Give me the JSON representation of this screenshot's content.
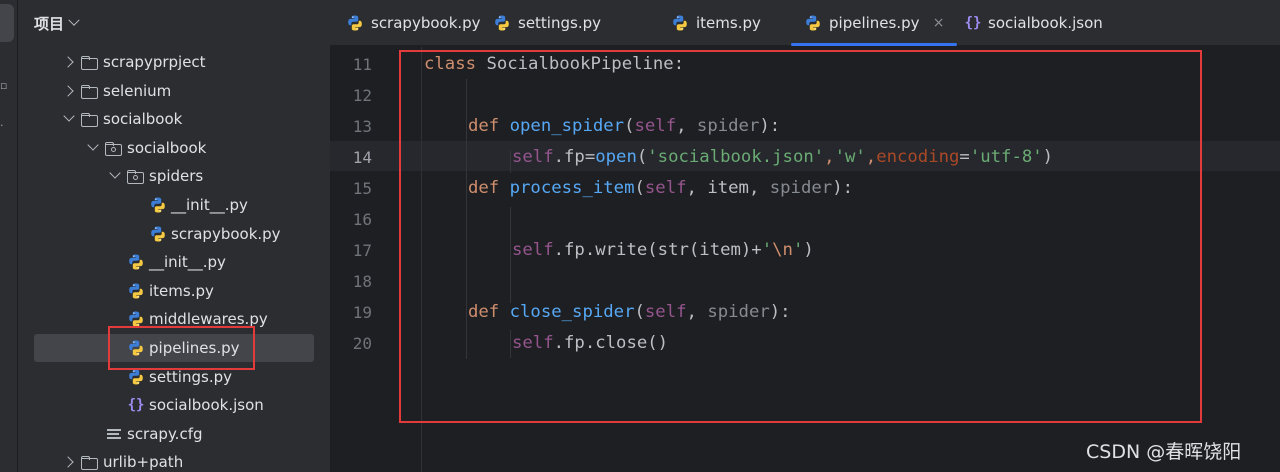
{
  "project": {
    "title": "项目",
    "tree": [
      {
        "label": "scrapyprpject",
        "type": "folder",
        "arrow": "right"
      },
      {
        "label": "selenium",
        "type": "folder",
        "arrow": "right"
      },
      {
        "label": "socialbook",
        "type": "folder",
        "arrow": "down"
      },
      {
        "label": "socialbook",
        "type": "package",
        "arrow": "down"
      },
      {
        "label": "spiders",
        "type": "package",
        "arrow": "down"
      },
      {
        "label": "__init__.py",
        "type": "py"
      },
      {
        "label": "scrapybook.py",
        "type": "py"
      },
      {
        "label": "__init__.py",
        "type": "py"
      },
      {
        "label": "items.py",
        "type": "py"
      },
      {
        "label": "middlewares.py",
        "type": "py"
      },
      {
        "label": "pipelines.py",
        "type": "py",
        "selected": true
      },
      {
        "label": "settings.py",
        "type": "py"
      },
      {
        "label": "socialbook.json",
        "type": "json"
      },
      {
        "label": "scrapy.cfg",
        "type": "cfg"
      },
      {
        "label": "urlib+path",
        "type": "folder",
        "arrow": "right"
      }
    ]
  },
  "tabs": [
    {
      "label": "scrapybook.py",
      "icon": "python-file-icon"
    },
    {
      "label": "settings.py",
      "icon": "python-file-icon"
    },
    {
      "label": "items.py",
      "icon": "python-file-icon"
    },
    {
      "label": "pipelines.py",
      "icon": "python-file-icon",
      "active": true,
      "close": "×"
    },
    {
      "label": "socialbook.json",
      "icon": "json-file-icon"
    }
  ],
  "json_icon_glyph": "{}",
  "editor": {
    "line_numbers": [
      "11",
      "12",
      "13",
      "14",
      "15",
      "16",
      "17",
      "18",
      "19",
      "20"
    ],
    "current_line": "14"
  },
  "code": {
    "l11": {
      "kw": "class",
      "name": "SocialbookPipeline",
      "colon": ":"
    },
    "l13": {
      "kw": "def",
      "fn": "open_spider",
      "p1": "(",
      "self": "self",
      "sep": ", ",
      "param": "spider",
      "p2": "):"
    },
    "l14": {
      "self": "self",
      "attr": ".fp=",
      "fn": "open",
      "p1": "(",
      "s1": "'socialbook.json'",
      "c1": ",",
      "s2": "'w'",
      "c2": ",",
      "kwarg": "encoding",
      "eq": "=",
      "s3": "'utf-8'",
      "p2": ")"
    },
    "l15": {
      "kw": "def",
      "fn": "process_item",
      "p1": "(",
      "self": "self",
      "sep": ", item, ",
      "param": "spider",
      "p2": "):"
    },
    "l17": {
      "self": "self",
      "rest": ".fp.write(str(item)+",
      "s1": "'",
      "esc": "\\n",
      "s2": "'",
      "p2": ")"
    },
    "l19": {
      "kw": "def",
      "fn": "close_spider",
      "p1": "(",
      "self": "self",
      "sep": ", ",
      "param": "spider",
      "p2": "):"
    },
    "l20": {
      "self": "self",
      "rest": ".fp.close()"
    }
  },
  "watermark": "CSDN @春晖饶阳",
  "colors": {
    "keyword": "#cf8e6d",
    "function": "#56a8f5",
    "self": "#94558d",
    "string": "#6aab73",
    "annotation_box": "#e33b3b",
    "accent": "#3574f0"
  }
}
